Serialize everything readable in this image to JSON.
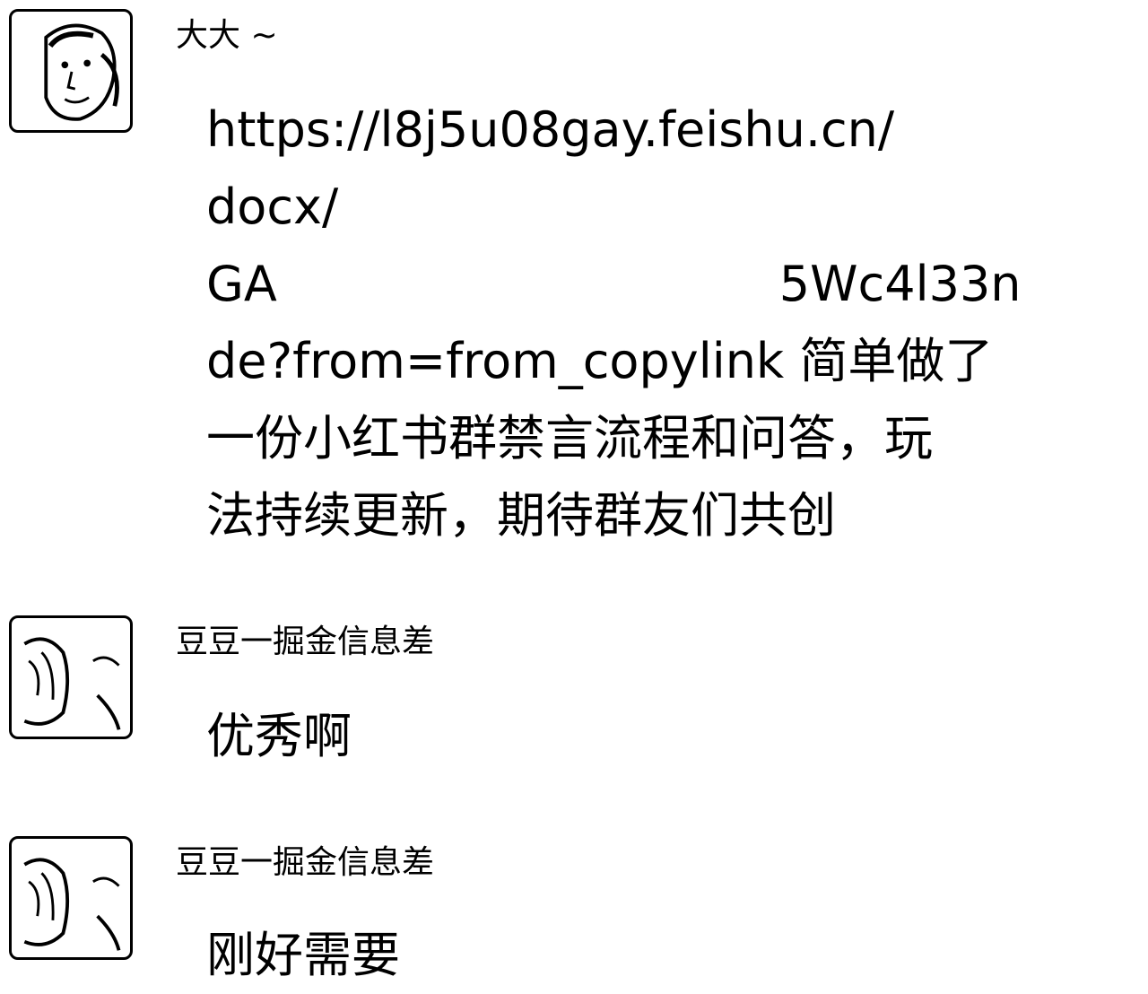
{
  "messages": [
    {
      "sender": "大大 ~",
      "lines": [
        "https://l8j5u08gay.feishu.cn/",
        "docx/",
        "GA",
        "5Wc4l33n",
        "de?from=from_copylink 简单做了",
        "一份小红书群禁言流程和问答，玩",
        "法持续更新，期待群友们共创"
      ]
    },
    {
      "sender": "豆豆一掘金信息差",
      "text": "优秀啊"
    },
    {
      "sender": "豆豆一掘金信息差",
      "text": "刚好需要"
    }
  ]
}
